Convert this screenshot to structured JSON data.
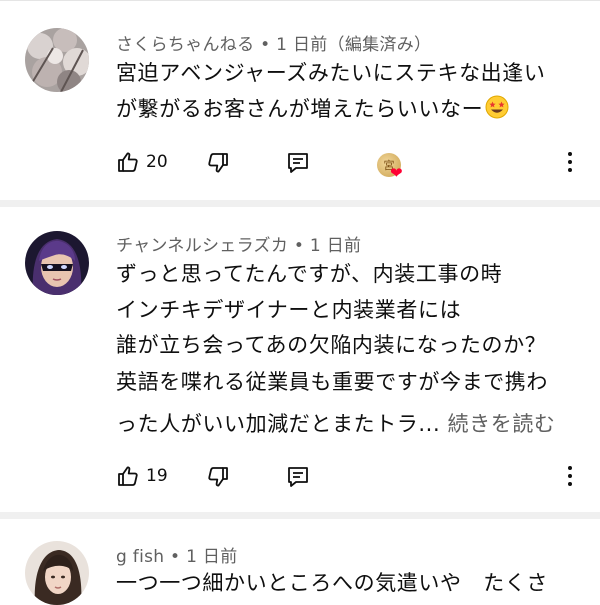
{
  "comments": [
    {
      "meta": "さくらちゃんねる • 1 日前（編集済み）",
      "lines": [
        "宮迫アベンジャーズみたいにステキな出逢い",
        "が繋がるお客さんが増えたらいいなー"
      ],
      "emoji": "star-struck-emoji",
      "likes": "20",
      "creator_heart_initial": "宮"
    },
    {
      "meta": "チャンネルシェラズカ • 1 日前",
      "lines": [
        "ずっと思ってたんですが、内装工事の時",
        "インチキデザイナーと内装業者には",
        "誰が立ち会ってあの欠陥内装になったのか？",
        "英語を喋れる従業員も重要ですが今まで携わ",
        "った人がいい加減だとまたトラ..."
      ],
      "read_more": "続きを読む",
      "likes": "19"
    },
    {
      "meta": "g fish • 1 日前",
      "lines": [
        "一つ一つ細かいところへの気遣いや　たくさ"
      ]
    }
  ],
  "icons": {
    "like": "thumbs-up-icon",
    "dislike": "thumbs-down-icon",
    "reply": "reply-icon",
    "more": "more-vert-icon"
  },
  "colors": {
    "text": "#0f0f0f",
    "secondary": "#606060",
    "divider": "#f0f0f0",
    "heart": "#ff0033"
  }
}
